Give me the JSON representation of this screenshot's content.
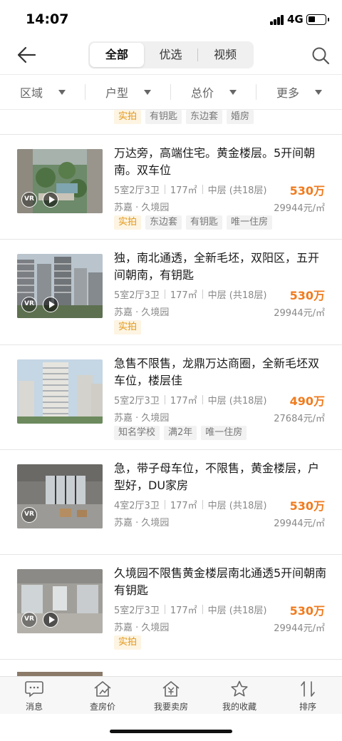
{
  "status_bar": {
    "time": "14:07",
    "network": "4G"
  },
  "nav": {
    "segments": [
      {
        "label": "全部",
        "active": true
      },
      {
        "label": "优选",
        "active": false
      },
      {
        "label": "视频",
        "active": false
      }
    ]
  },
  "filters": [
    "区域",
    "户型",
    "总价",
    "更多"
  ],
  "partial_tags": [
    "实拍",
    "有钥匙",
    "东边套",
    "婚房"
  ],
  "listings": [
    {
      "title": "万达旁，高端住宅。黄金楼层。5开间朝南。双车位",
      "layout": "5室2厅3卫",
      "area": "177㎡",
      "floor": "中层 (共18层)",
      "price": "530万",
      "community": "苏嘉 · 久境园",
      "unit_price": "29944元/㎡",
      "tags": [
        "实拍",
        "东边套",
        "有钥匙",
        "唯一住房"
      ],
      "vr": "VR",
      "has_video": true,
      "image": "garden-aerial"
    },
    {
      "title": "独，南北通透，全新毛坯，双阳区，五开间朝南，有钥匙",
      "layout": "5室2厅3卫",
      "area": "177㎡",
      "floor": "中层 (共18层)",
      "price": "530万",
      "community": "苏嘉 · 久境园",
      "unit_price": "29944元/㎡",
      "tags": [
        "实拍"
      ],
      "vr": "VR",
      "has_video": true,
      "image": "towers-view"
    },
    {
      "title": "急售不限售，龙鼎万达商圈，全新毛坯双车位，楼层佳",
      "layout": "5室2厅3卫",
      "area": "177㎡",
      "floor": "中层 (共18层)",
      "price": "490万",
      "community": "苏嘉 · 久境园",
      "unit_price": "27684元/㎡",
      "tags": [
        "知名学校",
        "满2年",
        "唯一住房"
      ],
      "vr": "",
      "has_video": false,
      "image": "building-exterior"
    },
    {
      "title": "急，带子母车位，不限售，黄金楼层，户型好，DU家房",
      "layout": "4室2厅3卫",
      "area": "177㎡",
      "floor": "中层 (共18层)",
      "price": "530万",
      "community": "苏嘉 · 久境园",
      "unit_price": "29944元/㎡",
      "tags": [],
      "vr": "VR",
      "has_video": false,
      "image": "empty-room"
    },
    {
      "title": "久境园不限售黄金楼层南北通透5开间朝南有钥匙",
      "layout": "5室2厅3卫",
      "area": "177㎡",
      "floor": "中层 (共18层)",
      "price": "530万",
      "community": "苏嘉 · 久境园",
      "unit_price": "29944元/㎡",
      "tags": [
        "实拍"
      ],
      "vr": "VR",
      "has_video": true,
      "image": "interior-room"
    }
  ],
  "tabbar": [
    {
      "label": "消息",
      "icon": "message-icon"
    },
    {
      "label": "查房价",
      "icon": "house-price-icon"
    },
    {
      "label": "我要卖房",
      "icon": "sell-house-icon"
    },
    {
      "label": "我的收藏",
      "icon": "star-icon"
    },
    {
      "label": "排序",
      "icon": "sort-icon"
    }
  ],
  "colors": {
    "price": "#f07b1e",
    "hot_tag": "#e2981a",
    "hot_tag_bg": "#fdf4e2"
  }
}
